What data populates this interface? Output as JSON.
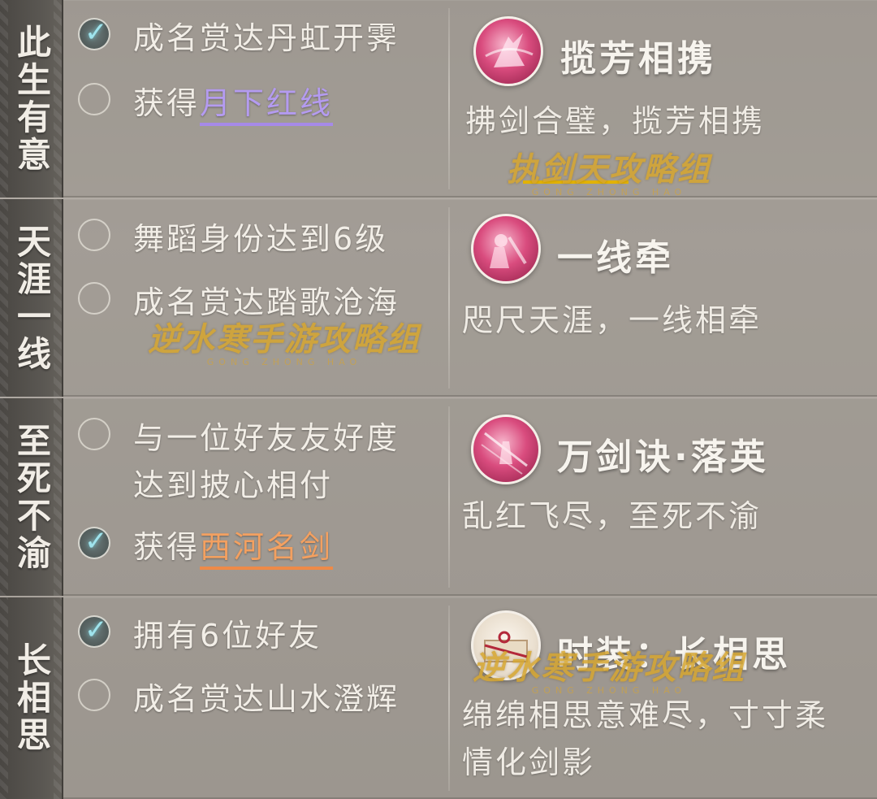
{
  "sections": [
    {
      "title": "此生有意",
      "conditions": [
        {
          "checked": true,
          "text": "成名赏达丹虹开霁",
          "highlight": ""
        },
        {
          "checked": false,
          "text": "获得",
          "highlight": "月下红线",
          "highlight_color": "#b49bf0"
        }
      ],
      "reward": {
        "icon": "sword-dancer-icon",
        "title": "揽芳相携",
        "desc": "拂剑合璧，揽芳相携"
      }
    },
    {
      "title": "天涯一线",
      "conditions": [
        {
          "checked": false,
          "text": "舞蹈身份达到6级",
          "highlight": ""
        },
        {
          "checked": false,
          "text": "成名赏达踏歌沧海",
          "highlight": ""
        }
      ],
      "reward": {
        "icon": "dance-pair-icon",
        "title": "一线牵",
        "desc": "咫尺天涯，一线相牵"
      }
    },
    {
      "title": "至死不渝",
      "conditions": [
        {
          "checked": false,
          "text": "与一位好友友好度达到披心相付",
          "line1": "与一位好友友好度",
          "line2": "达到披心相付",
          "highlight": ""
        },
        {
          "checked": true,
          "text": "获得",
          "highlight": "西河名剑",
          "highlight_color": "#f3a060"
        }
      ],
      "reward": {
        "icon": "sword-skill-icon",
        "title": "万剑诀·落英",
        "desc": "乱红飞尽，至死不渝"
      }
    },
    {
      "title": "长相思",
      "conditions": [
        {
          "checked": true,
          "text": "拥有6位好友",
          "highlight": ""
        },
        {
          "checked": false,
          "text": "成名赏达山水澄辉",
          "highlight": ""
        }
      ],
      "reward": {
        "icon": "gift-box-icon",
        "title": "时装：长相思",
        "desc": "绵绵相思意难尽，寸寸柔情化剑影",
        "desc_line1": "绵绵相思意难尽，寸寸柔",
        "desc_line2": "情化剑影"
      }
    }
  ],
  "watermark": {
    "main": "逆水寒手游攻略组",
    "sub": "GONG ZHONG HAO",
    "alt": "执剑天攻略组"
  },
  "colors": {
    "check": "#9fe3ec",
    "purple": "#b49bf0",
    "orange": "#f3a060",
    "side": "#4a4743"
  }
}
